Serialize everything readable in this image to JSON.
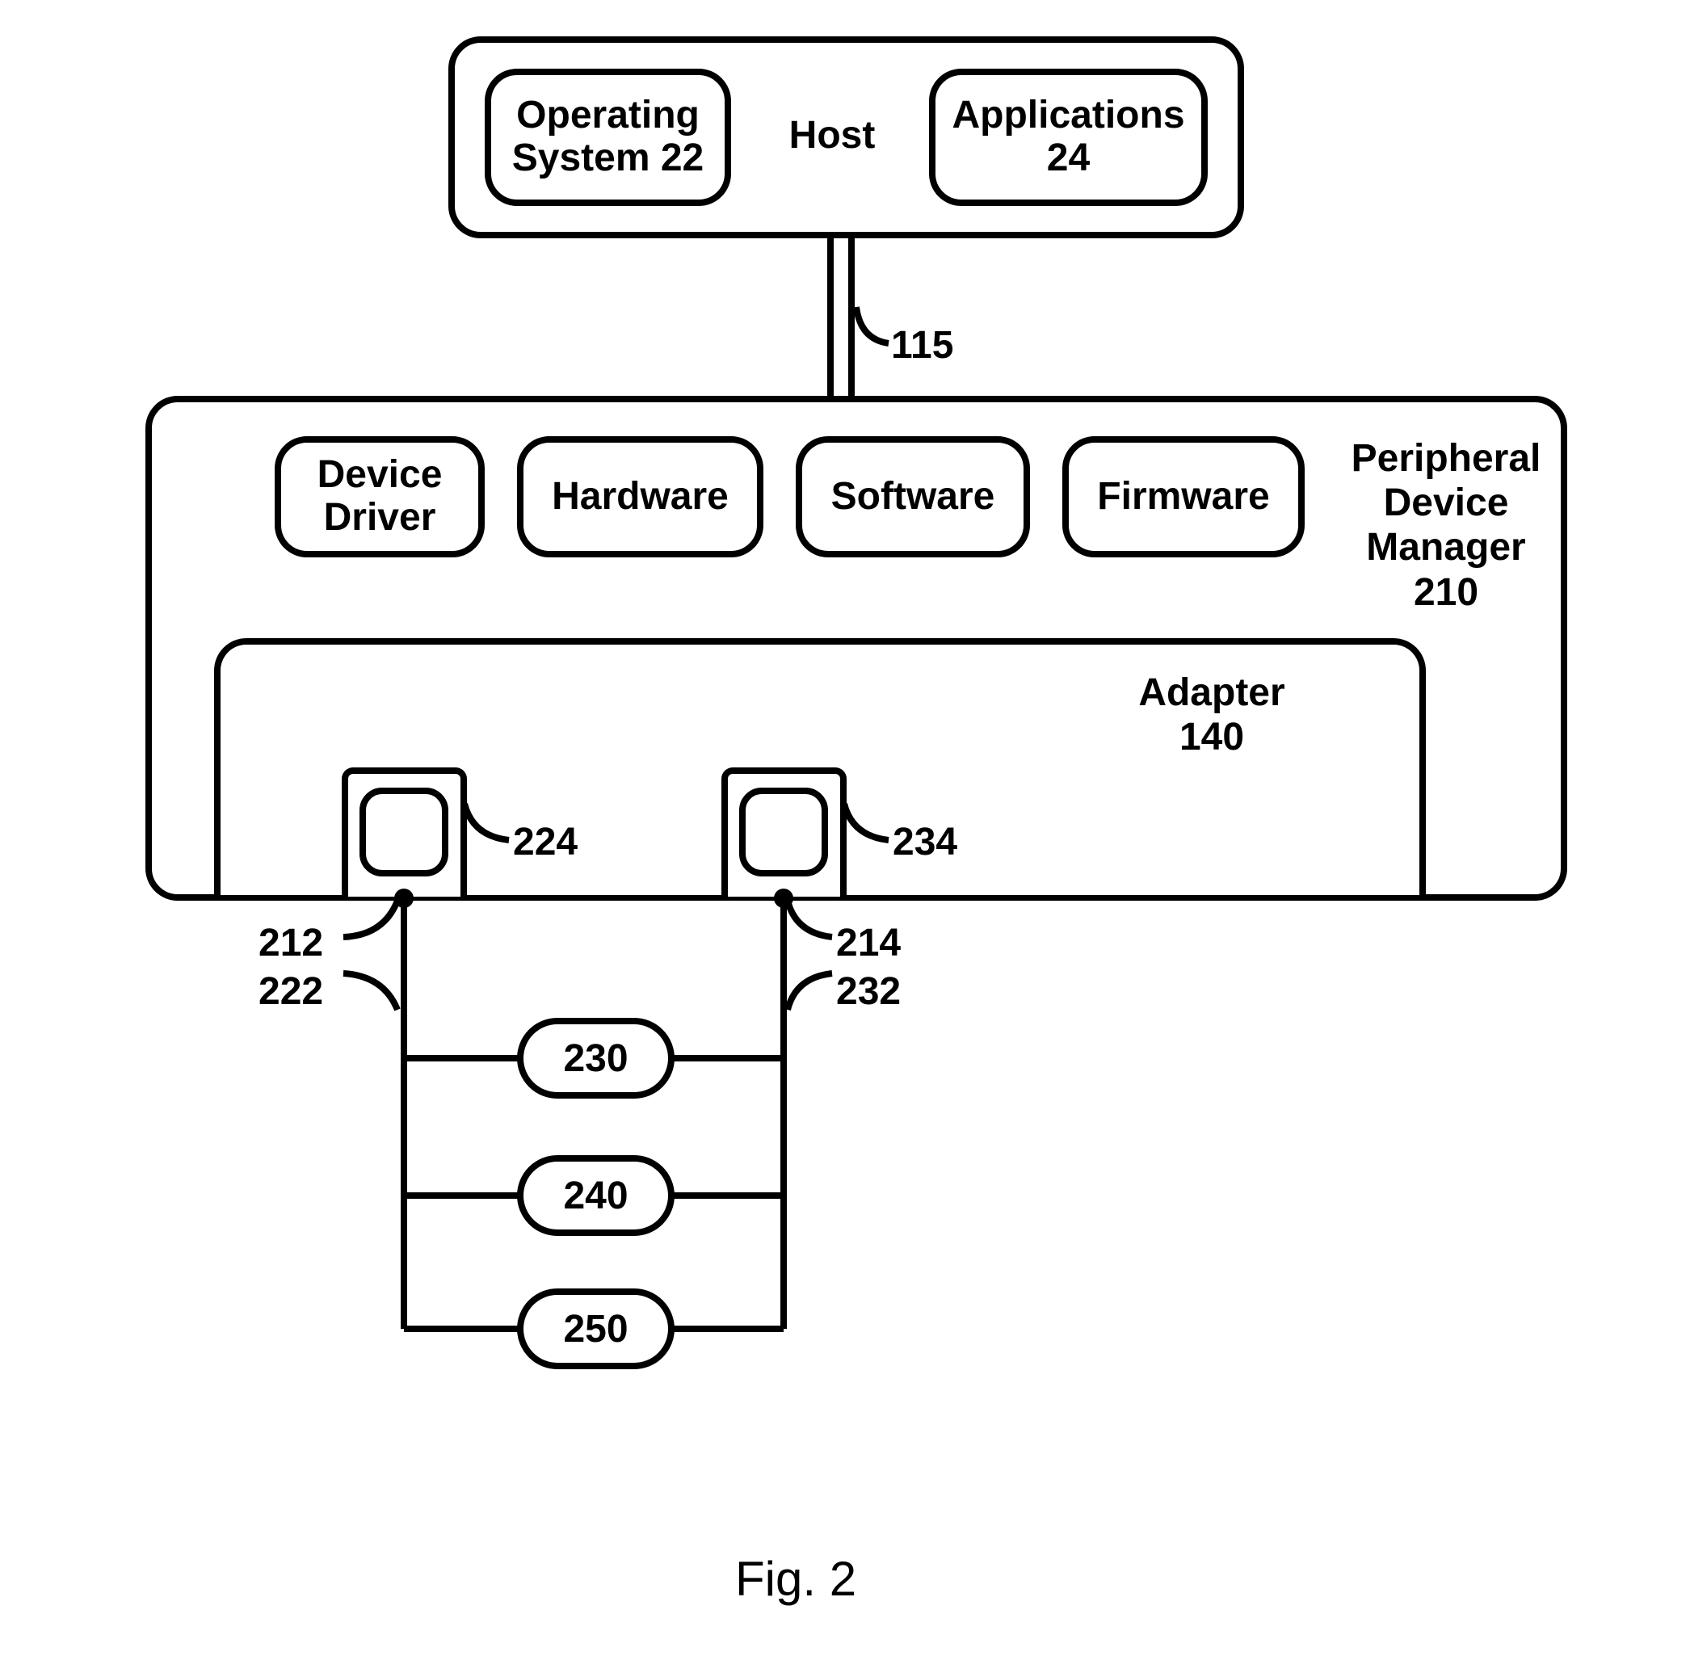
{
  "host": {
    "label": "Host",
    "os_label": "Operating System 22",
    "apps_label": "Applications 24"
  },
  "link_115": "115",
  "pdm": {
    "label": "Peripheral Device Manager 210",
    "device_driver": "Device Driver",
    "hardware": "Hardware",
    "software": "Software",
    "firmware": "Firmware",
    "adapter_label": "Adapter 140",
    "port_a": "224",
    "port_b": "234",
    "node_left_top": "212",
    "node_left_bottom": "222",
    "node_right_top": "214",
    "node_right_bottom": "232"
  },
  "bus_nodes": {
    "n1": "230",
    "n2": "240",
    "n3": "250"
  },
  "figure_caption": "Fig. 2"
}
